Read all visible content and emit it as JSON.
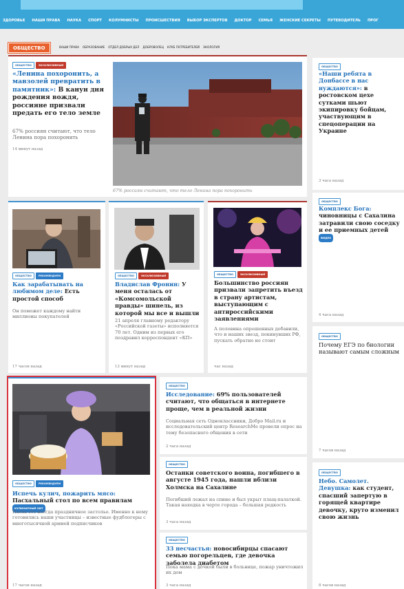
{
  "topnav": [
    "Здоровье",
    "Наши права",
    "Наука",
    "Спорт",
    "Колумнисты",
    "Происшествия",
    "Выбор экспертов",
    "Доктор",
    "Семья",
    "Женские секреты",
    "Путеводитель",
    "Прог"
  ],
  "section": {
    "label": "ОБЩЕСТВО",
    "subnav": [
      "ВАШИ ПРАВА",
      "ОБРАЗОВАНИЕ",
      "ОТДЕЛ ДОБРЫХ ДЕЛ",
      "ДОБРОВОЛЕЦ",
      "КЛУБ ПОТРЕБИТЕЛЕЙ",
      "ЭКОЛОГИЯ"
    ]
  },
  "tags": {
    "society": "общество",
    "exclusive": "эксклюзивный",
    "recommend": "рекомендуем",
    "culinary": "кулинарный хит",
    "video": "видео"
  },
  "main": {
    "headline_blue": "«Ленина похоронить, а мавзолей превратить в памятник»:",
    "headline_black": " В канун дня рождения вождя, россияне призвали предать его тело земле",
    "lead": "67% россиян считают, что тело Ленина пора похоронить",
    "time": "14 минут назад",
    "caption": "67% россиян считают, что тело Ленина пора похоронить"
  },
  "right1": {
    "headline_blue": "«Наши ребята в Донбассе в нас нуждаются»:",
    "headline_black": " в ростовском цехе сутками шьют экипировку бойцам, участвующим в спецоперации на Украине",
    "time": "3 часа назад"
  },
  "right2": {
    "headline_blue": "Комплекс Бога:",
    "headline_black": " чиновницы с Сахалина затравили свою соседку и ее приемных детей",
    "time": "4 часа назад"
  },
  "right3": {
    "headline_black": "Почему ЕГЭ по биологии называют самым сложным",
    "time": "7 часов назад"
  },
  "right4": {
    "headline_blue": "Небо. Самолет. Девушка:",
    "headline_black": " как студент, спасший запертую в горящей квартире девочку, круто изменил свою жизнь",
    "time": "8 часов назад"
  },
  "card1": {
    "headline_blue": "Как зарабатывать на любимом деле:",
    "headline_black": " Есть простой способ",
    "lead": "Он поможет каждому найти миллионы покупателей",
    "time": "17 часов назад"
  },
  "card2": {
    "headline_blue": "Владислав Фронин:",
    "headline_black": " У меня осталась от «Комсомольской правды» шинель, из которой мы все и вышли",
    "lead": "21 апреля главному редактору «Российской газеты» исполняется 70 лет. Одним из первых его поздравил корреспондент «КП»",
    "time": "13 минут назад"
  },
  "card3": {
    "headline_black": "Большинство россиян призвали запретить въезд в страну артистам, выступающим с антироссийскими заявлениями",
    "lead": "А половина опрошенных добавили, что и наших звезд, покинувших РФ, пускать обратно не стоит",
    "time": "час назад"
  },
  "card4": {
    "headline_blue": "Испечь кулич, пожарить мясо:",
    "headline_black": " Пасхальный стол по всем правилам",
    "lead": "Пасха это всегда праздничное застолье. Именно к нему готовились наши участницы – известные фудблогеры с многотысячной армией подписчиков",
    "time": "17 часов назад"
  },
  "list": [
    {
      "headline_blue": "Исследование:",
      "headline_black": " 69% пользователей считают, что общаться в интернете проще, чем в реальной жизни",
      "lead": "Социальная сеть Одноклассники, Добро Mail.ru и исследовательский центр ResearchMe провели опрос на тему безопасного общения в сети",
      "time": "2 часа назад"
    },
    {
      "headline_blue": "",
      "headline_black": "Останки советского воина, погибшего в августе 1945 года, нашли вблизи Холмска на Сахалине",
      "lead": "Погибший лежал на спине и был укрыт плащ-палаткой. Такая находка в черте города – большая редкость",
      "time": "3 часа назад"
    },
    {
      "headline_blue": "33 несчастья:",
      "headline_black": " новосибирцы спасают семью погорельцев, где девочка заболела диабетом",
      "lead": "Пока мама с дочкой были в больнице, пожар уничтожил их дом",
      "time": "3 часа назад"
    }
  ]
}
